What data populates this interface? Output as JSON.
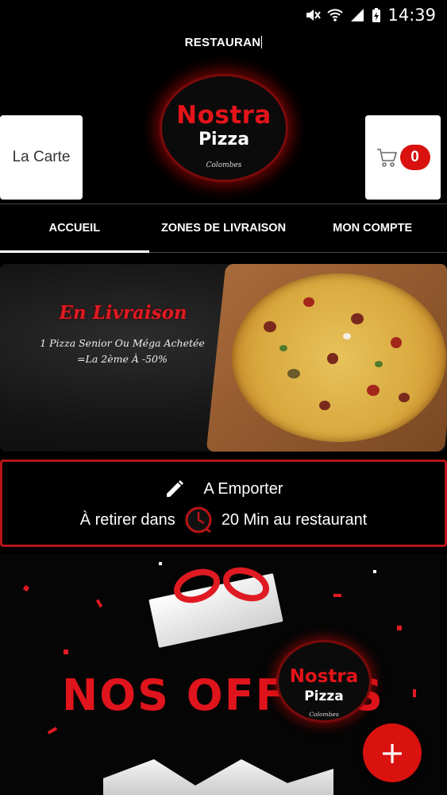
{
  "status_bar": {
    "time": "14:39",
    "icons": [
      "mute-icon",
      "wifi-icon",
      "signal-icon",
      "battery-charging-icon"
    ]
  },
  "header": {
    "title": "RESTAURAN",
    "menu_button_label": "La Carte",
    "cart_count": "0",
    "logo": {
      "line1": "Nostra",
      "line2": "Pizza",
      "line3": "Colombes"
    }
  },
  "tabs": [
    {
      "label": "ACCUEIL",
      "active": true
    },
    {
      "label": "ZONES DE LIVRAISON",
      "active": false
    },
    {
      "label": "MON COMPTE",
      "active": false
    }
  ],
  "promo_banner": {
    "title": "En Livraison",
    "line1": "1 Pizza Senior Ou Méga Achetée",
    "line2": "=La 2ème À -50%"
  },
  "takeaway": {
    "title": "A Emporter",
    "prefix": "À retirer dans",
    "suffix": "20 Min au restaurant"
  },
  "offers": {
    "title": "NOS OFFRES",
    "logo": {
      "line1": "Nostra",
      "line2": "Pizza",
      "line3": "Colombes"
    }
  },
  "fab_label": "+",
  "colors": {
    "accent": "#d9120f",
    "background": "#000000",
    "button_bg": "#ffffff"
  }
}
